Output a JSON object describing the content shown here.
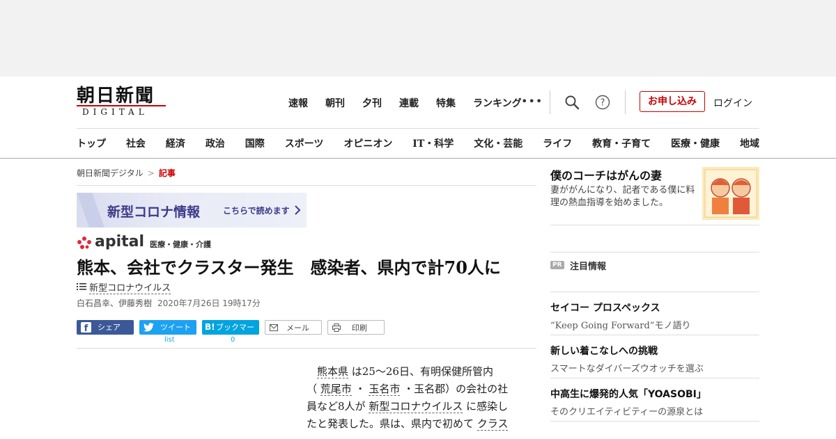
{
  "logo": {
    "main": "朝日新聞",
    "sub": "DIGITAL"
  },
  "top_nav": [
    "速報",
    "朝刊",
    "夕刊",
    "連載",
    "特集",
    "ランキング"
  ],
  "more_label": "•••",
  "apply_label": "お申し込み",
  "login_label": "ログイン",
  "categories": [
    "トップ",
    "社会",
    "経済",
    "政治",
    "国際",
    "スポーツ",
    "オピニオン",
    "IT・科学",
    "文化・芸能",
    "ライフ",
    "教育・子育て",
    "医療・健康",
    "地域"
  ],
  "breadcrumb": {
    "home": "朝日新聞デジタル",
    "sep": ">",
    "current": "記事"
  },
  "corona_banner": {
    "title": "新型コロナ情報",
    "cta": "こちらで読めます"
  },
  "apital": {
    "logo": "apital",
    "sub": "医療・健康・介護"
  },
  "article": {
    "title": "熊本、会社でクラスター発生　感染者、県内で計70人に",
    "tag": "新型コロナウイルス",
    "authors": "白石昌幸、伊藤秀樹",
    "date": "2020年7月26日 19時17分",
    "body": {
      "l1a": "熊本県",
      "l1b": " は25～26日、有明保健所管内",
      "l2a": "（ ",
      "l2b": "荒尾市",
      "l2c": " ・ ",
      "l2d": "玉名市",
      "l2e": " ・玉名郡）の会社の社",
      "l3a": "員など8人が ",
      "l3b": "新型コロナウイルス",
      "l3c": " に感染し",
      "l4a": "たと発表した。県は、県内で初めて ",
      "l4b": "クラス"
    }
  },
  "share": {
    "facebook": "シェア",
    "twitter": "ツイート",
    "hatena": "ブックマーク",
    "hatena_icon": "B!",
    "mail": "メール",
    "print": "印刷",
    "twitter_count": "list",
    "hatena_count": "0"
  },
  "sidebar": {
    "coach": {
      "title": "僕のコーチはがんの妻",
      "desc": "妻ががんになり、記者である僕に料理の熱血指導を始めました。"
    },
    "pr_badge": "PR",
    "pr_label": "注目情報",
    "pr_items": [
      {
        "title": "セイコー プロスペックス",
        "sub": "“Keep Going Forward”モノ語り"
      },
      {
        "title": "新しい着こなしへの挑戦",
        "sub": "スマートなダイバーズウオッチを選ぶ"
      },
      {
        "title": "中高生に爆発的人気「YOASOBI」",
        "sub": "そのクリエイティビティーの源泉とは"
      }
    ]
  },
  "colors": {
    "accent": "#c00000",
    "facebook": "#3b5998",
    "twitter": "#1da1f2",
    "hatena": "#00a4de",
    "corona": "#3d3a8a"
  }
}
